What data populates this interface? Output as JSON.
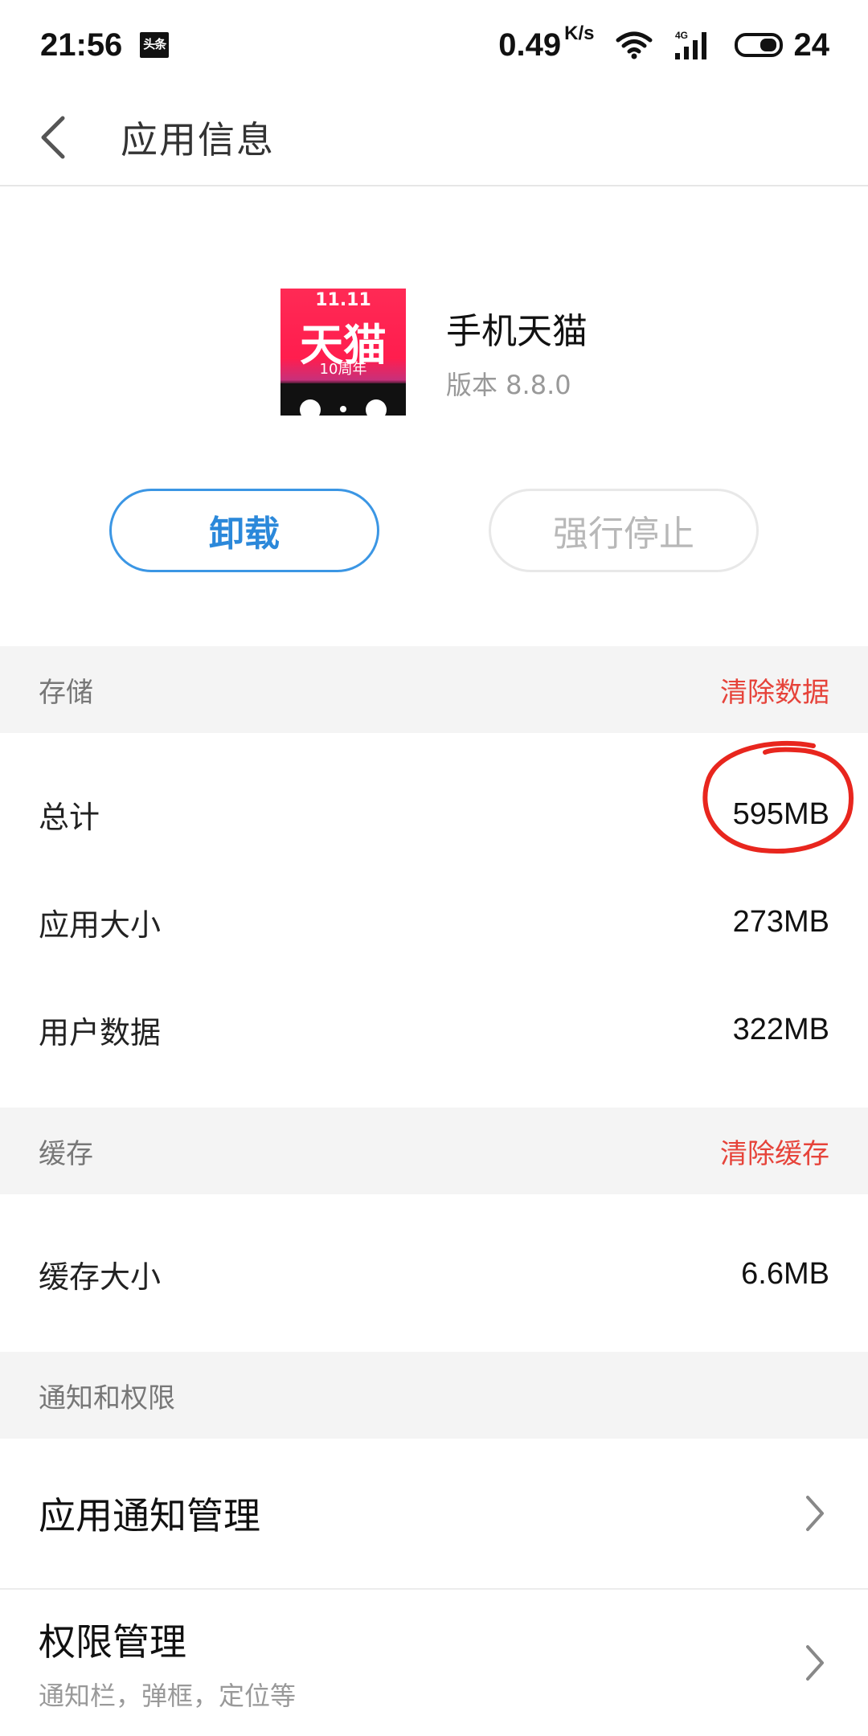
{
  "status_bar": {
    "time": "21:56",
    "notif_icon_label": "头条",
    "net_speed": "0.49",
    "net_unit": "K/s",
    "network_type": "4G",
    "battery": "24"
  },
  "header": {
    "title": "应用信息"
  },
  "app": {
    "name": "手机天猫",
    "version": "版本 8.8.0",
    "icon_top": "11.11",
    "icon_main": "天猫",
    "icon_sub": "10周年"
  },
  "buttons": {
    "uninstall": "卸载",
    "force_stop": "强行停止"
  },
  "storage": {
    "header": "存储",
    "action": "清除数据",
    "rows": [
      {
        "label": "总计",
        "value": "595MB"
      },
      {
        "label": "应用大小",
        "value": "273MB"
      },
      {
        "label": "用户数据",
        "value": "322MB"
      }
    ]
  },
  "cache": {
    "header": "缓存",
    "action": "清除缓存",
    "rows": [
      {
        "label": "缓存大小",
        "value": "6.6MB"
      }
    ]
  },
  "permissions": {
    "header": "通知和权限",
    "items": [
      {
        "title": "应用通知管理",
        "subtitle": ""
      },
      {
        "title": "权限管理",
        "subtitle": "通知栏，弹框，定位等"
      }
    ]
  },
  "colors": {
    "accent_blue": "#2b88da",
    "action_red": "#e6433a",
    "annotation_red": "#e8261e",
    "section_bg": "#f4f4f4"
  }
}
